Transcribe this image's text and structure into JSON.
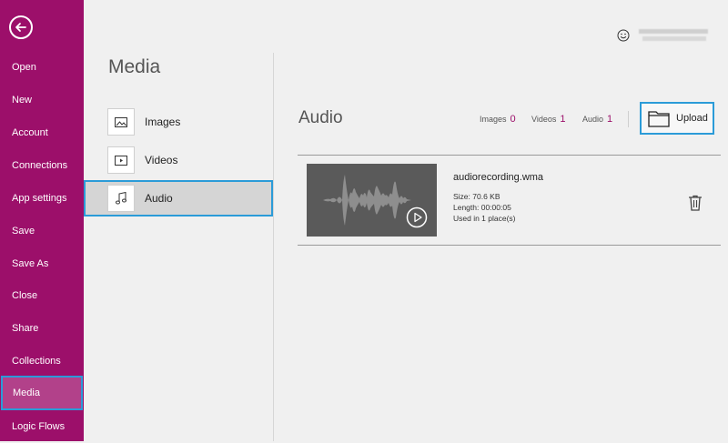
{
  "nav": {
    "items": [
      "Open",
      "New",
      "Account",
      "Connections",
      "App settings",
      "Save",
      "Save As",
      "Close",
      "Share",
      "Collections",
      "Media",
      "Logic Flows"
    ],
    "active": "Media",
    "colors": {
      "background": "#9c0f6a",
      "active_bg": "#b2418a",
      "focus_border": "#2b9bd8"
    }
  },
  "media": {
    "title": "Media",
    "categories": [
      {
        "label": "Images",
        "icon": "image-icon"
      },
      {
        "label": "Videos",
        "icon": "video-icon"
      },
      {
        "label": "Audio",
        "icon": "music-note-icon"
      }
    ],
    "active": "Audio"
  },
  "main": {
    "section_title": "Audio",
    "counts": [
      {
        "label": "Images",
        "value": "0"
      },
      {
        "label": "Videos",
        "value": "1"
      },
      {
        "label": "Audio",
        "value": "1"
      }
    ],
    "upload_label": "Upload",
    "file": {
      "name": "audiorecording.wma",
      "size": "Size: 70.6 KB",
      "length": "Length: 00:00:05",
      "used": "Used in 1 place(s)"
    }
  },
  "header": {
    "feedback_icon": "smiley-icon"
  }
}
